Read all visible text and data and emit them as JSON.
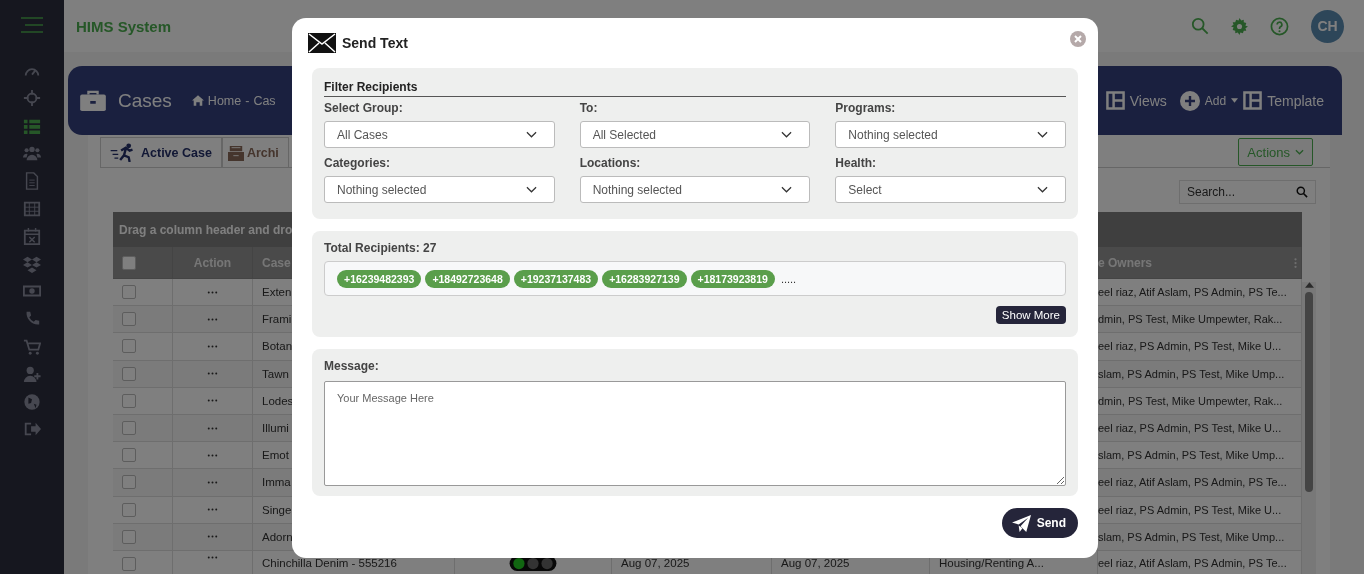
{
  "app": {
    "title": "HIMS System",
    "avatar": "CH"
  },
  "sidebar": {
    "items": [
      {
        "selected": false
      },
      {
        "selected": false
      },
      {
        "selected": true
      },
      {
        "selected": false
      },
      {
        "selected": false
      },
      {
        "selected": false
      },
      {
        "selected": false
      },
      {
        "selected": false
      },
      {
        "selected": false
      },
      {
        "selected": false
      },
      {
        "selected": false
      },
      {
        "selected": false
      },
      {
        "selected": false
      },
      {
        "selected": false
      }
    ]
  },
  "page": {
    "title": "Cases",
    "breadcrumb": [
      "Home",
      "-",
      "Cas"
    ],
    "actions": [
      "Views",
      "Add",
      "Template"
    ]
  },
  "tabs": [
    {
      "label": "Active Case",
      "selected": true
    },
    {
      "label": "Archi",
      "selected": false
    }
  ],
  "toolbar": {
    "actions_button": "Actions",
    "search_placeholder": "Search..."
  },
  "grid": {
    "group_hint": "Drag a column header and dro",
    "all_checked": false,
    "columns": [
      "Action",
      "Case",
      "e Owners"
    ],
    "rows": [
      {
        "checked": false,
        "case": "Exten",
        "owners": "eel riaz, Atif Aslam, PS Admin, PS Te..."
      },
      {
        "checked": false,
        "case": "Frami",
        "owners": "dmin, PS Test, Mike Umpewter, Rak..."
      },
      {
        "checked": false,
        "case": "Botan",
        "owners": "eel riaz, PS Admin, PS Test, Mike U..."
      },
      {
        "checked": false,
        "case": "Tawn",
        "owners": "slam, PS Admin, PS Test, Mike Ump..."
      },
      {
        "checked": false,
        "case": "Lodes",
        "owners": "dmin, PS Test, Mike Umpewter, Rak..."
      },
      {
        "checked": false,
        "case": "Illumi",
        "owners": "eel riaz, PS Admin, PS Test, Mike U..."
      },
      {
        "checked": false,
        "case": "Emot",
        "owners": "slam, PS Admin, PS Test, Mike Ump..."
      },
      {
        "checked": false,
        "case": "Imma",
        "owners": "eel riaz, Atif Aslam, PS Admin, PS Te..."
      },
      {
        "checked": false,
        "case": "Singe",
        "owners": "eel riaz, PS Admin, PS Test, Mike U..."
      },
      {
        "checked": false,
        "case": "Adorn",
        "owners": "slam, PS Admin, PS Test, Mike Ump..."
      },
      {
        "checked": false,
        "case": "Chinchilla Denim - 555216",
        "status": true,
        "start": "Aug 07, 2025",
        "end": "Aug 07, 2025",
        "type": "Housing/Renting A...",
        "owners": "eel riaz, Atif Aslam, PS Admin, PS Te..."
      }
    ]
  },
  "modal": {
    "title": "Send Text",
    "filter": {
      "title": "Filter Recipients",
      "fields": [
        {
          "label": "Select Group:",
          "value": "All Cases"
        },
        {
          "label": "To:",
          "value": "All Selected"
        },
        {
          "label": "Programs:",
          "value": "Nothing selected"
        },
        {
          "label": "Categories:",
          "value": "Nothing selected"
        },
        {
          "label": "Locations:",
          "value": "Nothing selected"
        },
        {
          "label": "Health:",
          "value": "Select"
        }
      ]
    },
    "recipients": {
      "label": "Total Recipients: 27",
      "numbers": [
        "+16239482393",
        "+18492723648",
        "+19237137483",
        "+16283927139",
        "+18173923819"
      ],
      "more": ".....",
      "show_more": "Show More"
    },
    "message": {
      "label": "Message:",
      "placeholder": "Your Message Here"
    },
    "send": "Send"
  }
}
